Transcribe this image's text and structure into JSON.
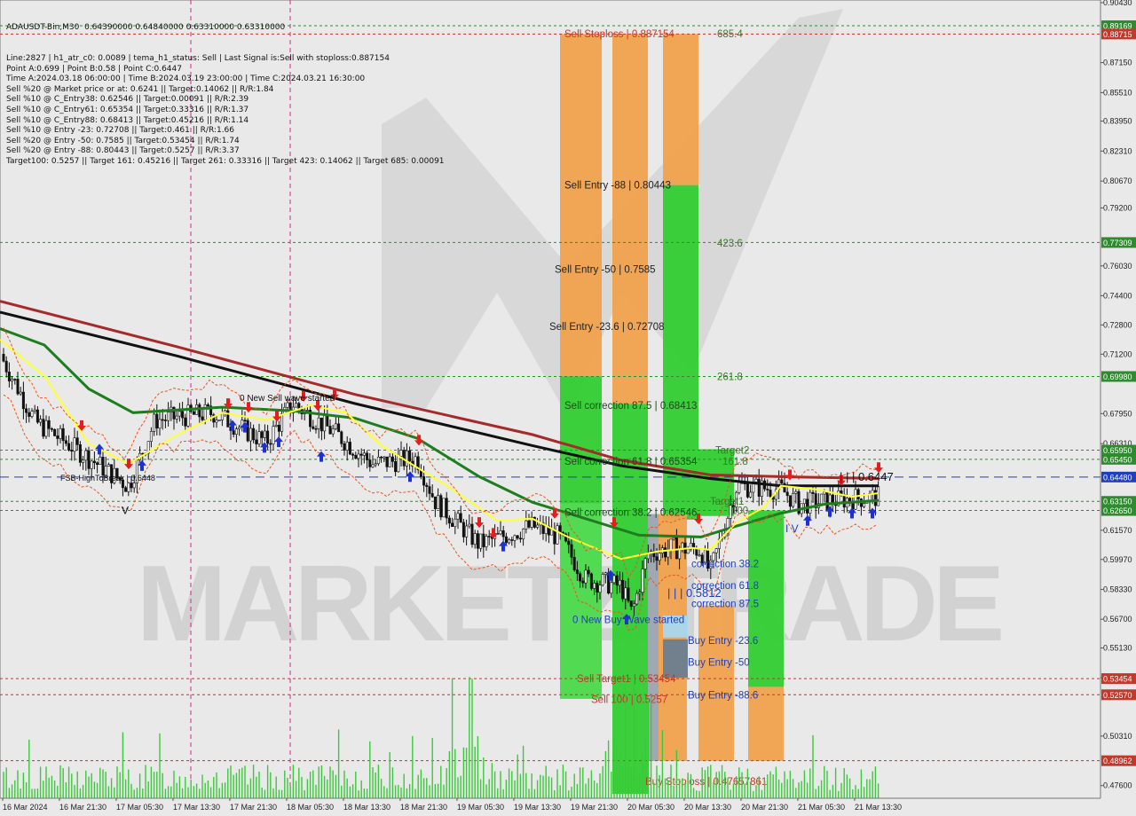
{
  "symbol_line": "ADAUSDT-Bin,M30  0.64390000 0.64840000 0.63310000 0.63310000",
  "info_lines": [
    "Line:2827 | h1_atr_c0: 0.0089 | tema_h1_status: Sell | Last Signal is:Sell with stoploss:0.887154",
    "Point A:0.699 | Point B:0.58 | Point C:0.6447",
    "Time A:2024.03.18 06:00:00 | Time B:2024.03.19 23:00:00 | Time C:2024.03.21 16:30:00",
    "Sell %20 @ Market price or at: 0.6241 || Target:0.14062 || R/R:1.84",
    "Sell %10 @ C_Entry38: 0.62546 || Target:0.00091 || R/R:2.39",
    "Sell %10 @ C_Entry61: 0.65354 || Target:0.33316 || R/R:1.37",
    "Sell %10 @ C_Entry88: 0.68413 || Target:0.45216 || R/R:1.14",
    "Sell %10 @ Entry -23: 0.72708 || Target:0.461 || R/R:1.66",
    "Sell %20 @ Entry -50: 0.7585 || Target:0.53454 || R/R:1.74",
    "Sell %20 @ Entry -88: 0.80443 || Target:0.5257 || R/R:3.37",
    "Target100: 0.5257 || Target 161: 0.45216 || Target 261: 0.33316 || Target 423: 0.14062 || Target 685: 0.00091"
  ],
  "price_axis": {
    "ticks": [
      {
        "label": "0.90430",
        "price": 0.9043
      },
      {
        "label": "0.87150",
        "price": 0.8715
      },
      {
        "label": "0.85510",
        "price": 0.8551
      },
      {
        "label": "0.83950",
        "price": 0.8395
      },
      {
        "label": "0.82310",
        "price": 0.8231
      },
      {
        "label": "0.80670",
        "price": 0.8067
      },
      {
        "label": "0.79200",
        "price": 0.792
      },
      {
        "label": "0.76030",
        "price": 0.7603
      },
      {
        "label": "0.74400",
        "price": 0.744
      },
      {
        "label": "0.72800",
        "price": 0.728
      },
      {
        "label": "0.71200",
        "price": 0.712
      },
      {
        "label": "0.67950",
        "price": 0.6795
      },
      {
        "label": "0.66310",
        "price": 0.6631
      },
      {
        "label": "0.61570",
        "price": 0.6157
      },
      {
        "label": "0.59970",
        "price": 0.5997
      },
      {
        "label": "0.58330",
        "price": 0.5833
      },
      {
        "label": "0.56700",
        "price": 0.567
      },
      {
        "label": "0.55130",
        "price": 0.5513
      },
      {
        "label": "0.53500",
        "price": 0.535
      },
      {
        "label": "0.50310",
        "price": 0.5031
      },
      {
        "label": "0.47600",
        "price": 0.476
      }
    ],
    "badges": [
      {
        "label": "0.89169",
        "price": 0.89169,
        "color": "#2e8b2e"
      },
      {
        "label": "0.88715",
        "price": 0.88715,
        "color": "#c0392b"
      },
      {
        "label": "0.77309",
        "price": 0.77309,
        "color": "#2e8b2e"
      },
      {
        "label": "0.69980",
        "price": 0.6998,
        "color": "#2e8b2e"
      },
      {
        "label": "0.65950",
        "price": 0.6595,
        "color": "#2e8b2e"
      },
      {
        "label": "0.65450",
        "price": 0.6545,
        "color": "#2e8b2e"
      },
      {
        "label": "0.64480",
        "price": 0.6448,
        "color": "#1f3fbf"
      },
      {
        "label": "0.63150",
        "price": 0.6315,
        "color": "#2e8b2e"
      },
      {
        "label": "0.62650",
        "price": 0.6265,
        "color": "#2e8b2e"
      },
      {
        "label": "0.53454",
        "price": 0.53454,
        "color": "#c0392b"
      },
      {
        "label": "0.52570",
        "price": 0.5257,
        "color": "#c0392b"
      },
      {
        "label": "0.48962",
        "price": 0.48962,
        "color": "#c0392b"
      }
    ]
  },
  "time_axis": [
    "16 Mar 2024",
    "16 Mar 21:30",
    "17 Mar 05:30",
    "17 Mar 13:30",
    "17 Mar 21:30",
    "18 Mar 05:30",
    "18 Mar 13:30",
    "18 Mar 21:30",
    "19 Mar 05:30",
    "19 Mar 13:30",
    "19 Mar 21:30",
    "20 Mar 05:30",
    "20 Mar 13:30",
    "20 Mar 21:30",
    "21 Mar 05:30",
    "21 Mar 13:30"
  ],
  "chart_labels": [
    {
      "text": "Sell Stoploss | 0.887154",
      "color": "#c0392b",
      "price": 0.8872,
      "anchor": "col_left_a"
    },
    {
      "text": "685.4",
      "color": "#3d7a2a",
      "price": 0.8872,
      "anchor": "fib"
    },
    {
      "text": "Sell Entry -88 | 0.80443",
      "color": "#222222",
      "price": 0.8045,
      "anchor": "col_left_a"
    },
    {
      "text": "423.6",
      "color": "#3d7a2a",
      "price": 0.7728,
      "anchor": "fib"
    },
    {
      "text": "Sell Entry -50 | 0.7585",
      "color": "#222222",
      "price": 0.7585,
      "anchor": "col_left_b"
    },
    {
      "text": "Sell Entry -23.6 | 0.72708",
      "color": "#222222",
      "price": 0.7271,
      "anchor": "col_left_c"
    },
    {
      "text": "261.8",
      "color": "#3d7a2a",
      "price": 0.6998,
      "anchor": "fib"
    },
    {
      "text": "Sell correction 87.5 | 0.68413",
      "color": "#1e4a1e",
      "price": 0.6841,
      "anchor": "col_left_a"
    },
    {
      "text": "Sell correction 61.8 | 0.65354",
      "color": "#1e4a1e",
      "price": 0.6535,
      "anchor": "col_left_a"
    },
    {
      "text": "Target2",
      "color": "#3d7a2a",
      "price": 0.6595,
      "anchor": "fib_t2"
    },
    {
      "text": "161.8",
      "color": "#3d7a2a",
      "price": 0.6535,
      "anchor": "fib_161"
    },
    {
      "text": "Sell correction 38.2 | 0.62546",
      "color": "#1e4a1e",
      "price": 0.6255,
      "anchor": "col_left_a"
    },
    {
      "text": "Target1",
      "color": "#3d7a2a",
      "price": 0.6315,
      "anchor": "fib_t1"
    },
    {
      "text": "100",
      "color": "#3d7a2a",
      "price": 0.6265,
      "anchor": "fib_100"
    },
    {
      "text": "correction 38.2",
      "color": "#1f3fbf",
      "price": 0.5975,
      "anchor": "buy"
    },
    {
      "text": "correction 61.8",
      "color": "#1f3fbf",
      "price": 0.5855,
      "anchor": "buy"
    },
    {
      "text": "| | | 0.5812",
      "color": "#1f3fbf",
      "price": 0.5812,
      "anchor": "buy_pt"
    },
    {
      "text": "correction 87.5",
      "color": "#1f3fbf",
      "price": 0.5755,
      "anchor": "buy"
    },
    {
      "text": "0 New Buy Wave started",
      "color": "#1f3fbf",
      "price": 0.5668,
      "anchor": "buy_wave"
    },
    {
      "text": "Buy Entry -23.6",
      "color": "#1f3fbf",
      "price": 0.5555,
      "anchor": "buy_e"
    },
    {
      "text": "Buy Entry -50",
      "color": "#1f3fbf",
      "price": 0.5435,
      "anchor": "buy_e"
    },
    {
      "text": "Sell Target1 | 0.53454",
      "color": "#c0392b",
      "price": 0.5345,
      "anchor": "col_left_t"
    },
    {
      "text": "Buy Entry -88.6",
      "color": "#1f3fbf",
      "price": 0.5255,
      "anchor": "buy_e"
    },
    {
      "text": "Sell 100 | 0.5257",
      "color": "#c0392b",
      "price": 0.5232,
      "anchor": "col_left_s"
    },
    {
      "text": "Buy Stoploss | 0.47657861",
      "color": "#c0392b",
      "price": 0.4782,
      "anchor": "buy_sl"
    },
    {
      "text": "0 New Sell wave started",
      "color": "#111111",
      "price": 0.6885,
      "anchor": "sell_wave"
    },
    {
      "text": "FSB-HighToBreak | 0.6448",
      "color": "#111111",
      "price": 0.6448,
      "anchor": "fsb"
    },
    {
      "text": "| | | 0.6447",
      "color": "#111111",
      "price": 0.6447,
      "anchor": "pt_c"
    },
    {
      "text": "V",
      "color": "#111111",
      "price": 0.6265,
      "anchor": "v1"
    },
    {
      "text": "I V",
      "color": "#1f3fbf",
      "price": 0.6165,
      "anchor": "iv"
    }
  ],
  "watermark": "MARKETZITRADE",
  "colors": {
    "background": "#e9e9e9",
    "bull_green": "#32cd32",
    "light_green": "#6be66b",
    "sell_orange": "#f0a24c",
    "ma_red": "#a52a2a",
    "ma_black": "#111111",
    "ma_green": "#1e7d1e",
    "ma_yellow": "#ffff33",
    "current_price": "#1f3fbf"
  },
  "icons": [
    "sell-arrow-icon",
    "buy-arrow-icon"
  ]
}
